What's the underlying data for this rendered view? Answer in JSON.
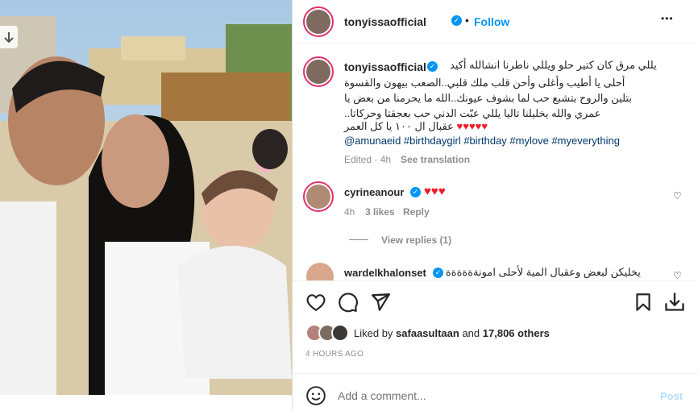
{
  "post": {
    "author": "tonyissaofficial",
    "follow_label": "Follow",
    "more_label": "•••"
  },
  "caption": {
    "author": "tonyissaofficial",
    "line1": "يللي مرق كان كتير حلو ويللي ناطرنا انشالله أكيد",
    "line2": "أحلى يا أطيب وأغلى وأحن قلب ملك قلبي..الصعب بيهون والقسوة",
    "line3": "بتلين والروح بتشبع حب لما بشوف عيونك..الله ما يحرمنا من بعض يا",
    "line4": "عمري والله يخليلنا تاليا يللي عبّت الدني حب بعجقتا وحركاتا..",
    "line5_text": "عقبال ال ١٠٠ يا كل العمر",
    "hashtags": "@amunaeid #birthdaygirl #birthday #mylove #myeverything",
    "meta_time": "Edited · 4h",
    "see_translation": "See translation"
  },
  "comments": [
    {
      "user": "cyrineanour",
      "time": "4h",
      "likes": "3 likes",
      "reply": "Reply"
    },
    {
      "user": "wardelkhalonset",
      "text": "يخليكن لبعض وعقبال المية لأحلى امونةةةةةة"
    }
  ],
  "view_replies": "View replies (1)",
  "likes_line": {
    "prefix": "Liked by",
    "user": "safaasultaan",
    "and": "and",
    "count": "17,806 others"
  },
  "timestamp": "4 HOURS AGO",
  "add_comment": {
    "placeholder": "Add a comment...",
    "post_label": "Post"
  },
  "icons": {
    "like": "heart-icon",
    "comment": "comment-icon",
    "share": "share-icon",
    "save": "bookmark-icon",
    "download": "download-icon",
    "emoji": "emoji-icon"
  },
  "colors": {
    "follow": "#0095f6",
    "link": "#00376b",
    "heart": "#ed1c24",
    "verified": "#0095f6"
  }
}
